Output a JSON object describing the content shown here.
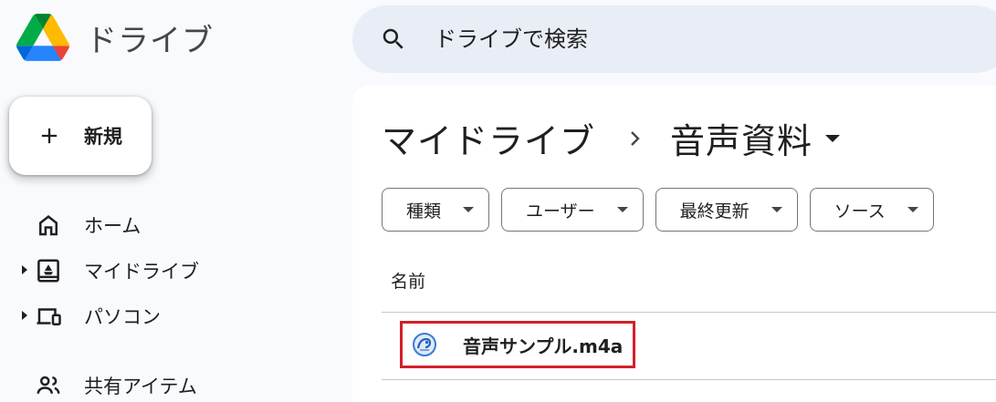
{
  "app": {
    "name": "ドライブ"
  },
  "search": {
    "placeholder": "ドライブで検索"
  },
  "new_button": {
    "label": "新規"
  },
  "sidebar": {
    "items": [
      {
        "label": "ホーム",
        "icon": "home-icon",
        "expandable": false
      },
      {
        "label": "マイドライブ",
        "icon": "my-drive-icon",
        "expandable": true
      },
      {
        "label": "パソコン",
        "icon": "computers-icon",
        "expandable": true
      },
      {
        "label": "共有アイテム",
        "icon": "shared-icon",
        "expandable": false
      }
    ]
  },
  "breadcrumb": {
    "root": "マイドライブ",
    "current": "音声資料"
  },
  "filters": [
    {
      "label": "種類"
    },
    {
      "label": "ユーザー"
    },
    {
      "label": "最終更新"
    },
    {
      "label": "ソース"
    }
  ],
  "file_list": {
    "column_header": "名前",
    "files": [
      {
        "name": "音声サンプル.m4a",
        "icon": "audio-file-icon"
      }
    ]
  },
  "colors": {
    "search_bg": "#e9eef6",
    "highlight": "#d32029",
    "drive_green": "#0f9d58",
    "drive_yellow": "#f4b400",
    "drive_blue": "#4285f4",
    "drive_red": "#db4437"
  }
}
